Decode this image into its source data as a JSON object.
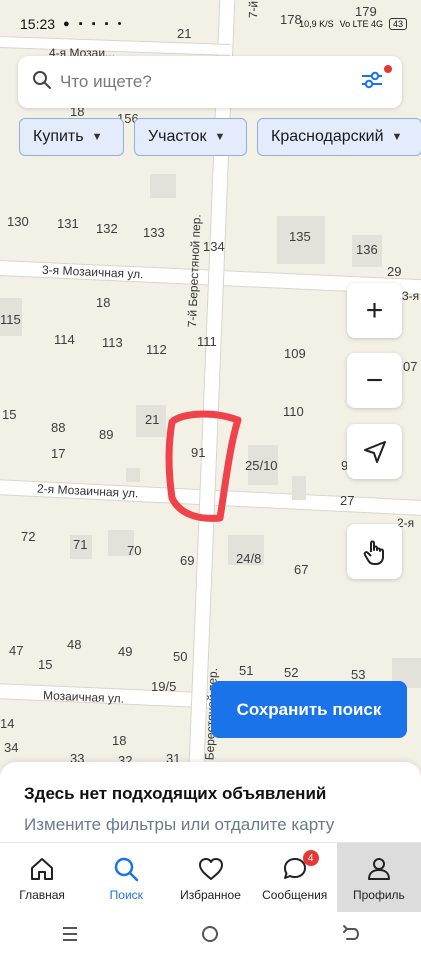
{
  "status_bar": {
    "time": "15:23",
    "network": "10,9 K/S",
    "signal": "Vo LTE 4G",
    "battery": "43"
  },
  "map": {
    "streets": [
      "3-я Мозаичная ул.",
      "2-я Мозаичная ул.",
      "Мозаичная ул.",
      "7-й Берестяной пер.",
      "4-я Мозаи...",
      "7-й",
      "2-я",
      "3-я",
      "й Берестяной пер."
    ],
    "house_numbers": [
      "178",
      "179",
      "21",
      "18",
      "156",
      "130",
      "131",
      "132",
      "133",
      "134",
      "135",
      "136",
      "29",
      "18",
      "115",
      "114",
      "113",
      "112",
      "111",
      "109",
      "07",
      "15",
      "88",
      "89",
      "21",
      "91",
      "110",
      "17",
      "25/10",
      "9",
      "27",
      "72",
      "71",
      "70",
      "69",
      "24/8",
      "67",
      "47",
      "48",
      "49",
      "50",
      "51",
      "52",
      "53",
      "15",
      "19/5",
      "14",
      "34",
      "18",
      "33",
      "32",
      "31"
    ]
  },
  "search": {
    "placeholder": "Что ищете?"
  },
  "filters": [
    {
      "label": "Купить"
    },
    {
      "label": "Участок"
    },
    {
      "label": "Краснодарский"
    }
  ],
  "map_controls": {
    "zoom_in": "+",
    "zoom_out": "−"
  },
  "save_search": {
    "label": "Сохранить поиск"
  },
  "sheet": {
    "title": "Здесь нет подходящих объявлений",
    "subtitle": "Измените фильтры или отдалите карту"
  },
  "tabs": [
    {
      "label": "Главная",
      "icon": "home-icon"
    },
    {
      "label": "Поиск",
      "icon": "search-icon"
    },
    {
      "label": "Избранное",
      "icon": "heart-icon"
    },
    {
      "label": "Сообщения",
      "icon": "chat-icon",
      "badge": "4"
    },
    {
      "label": "Профиль",
      "icon": "profile-icon"
    }
  ],
  "colors": {
    "accent": "#1a73e8",
    "chip_bg": "#e4ecfb",
    "badge": "#e53935",
    "annotation": "#f0424a"
  }
}
